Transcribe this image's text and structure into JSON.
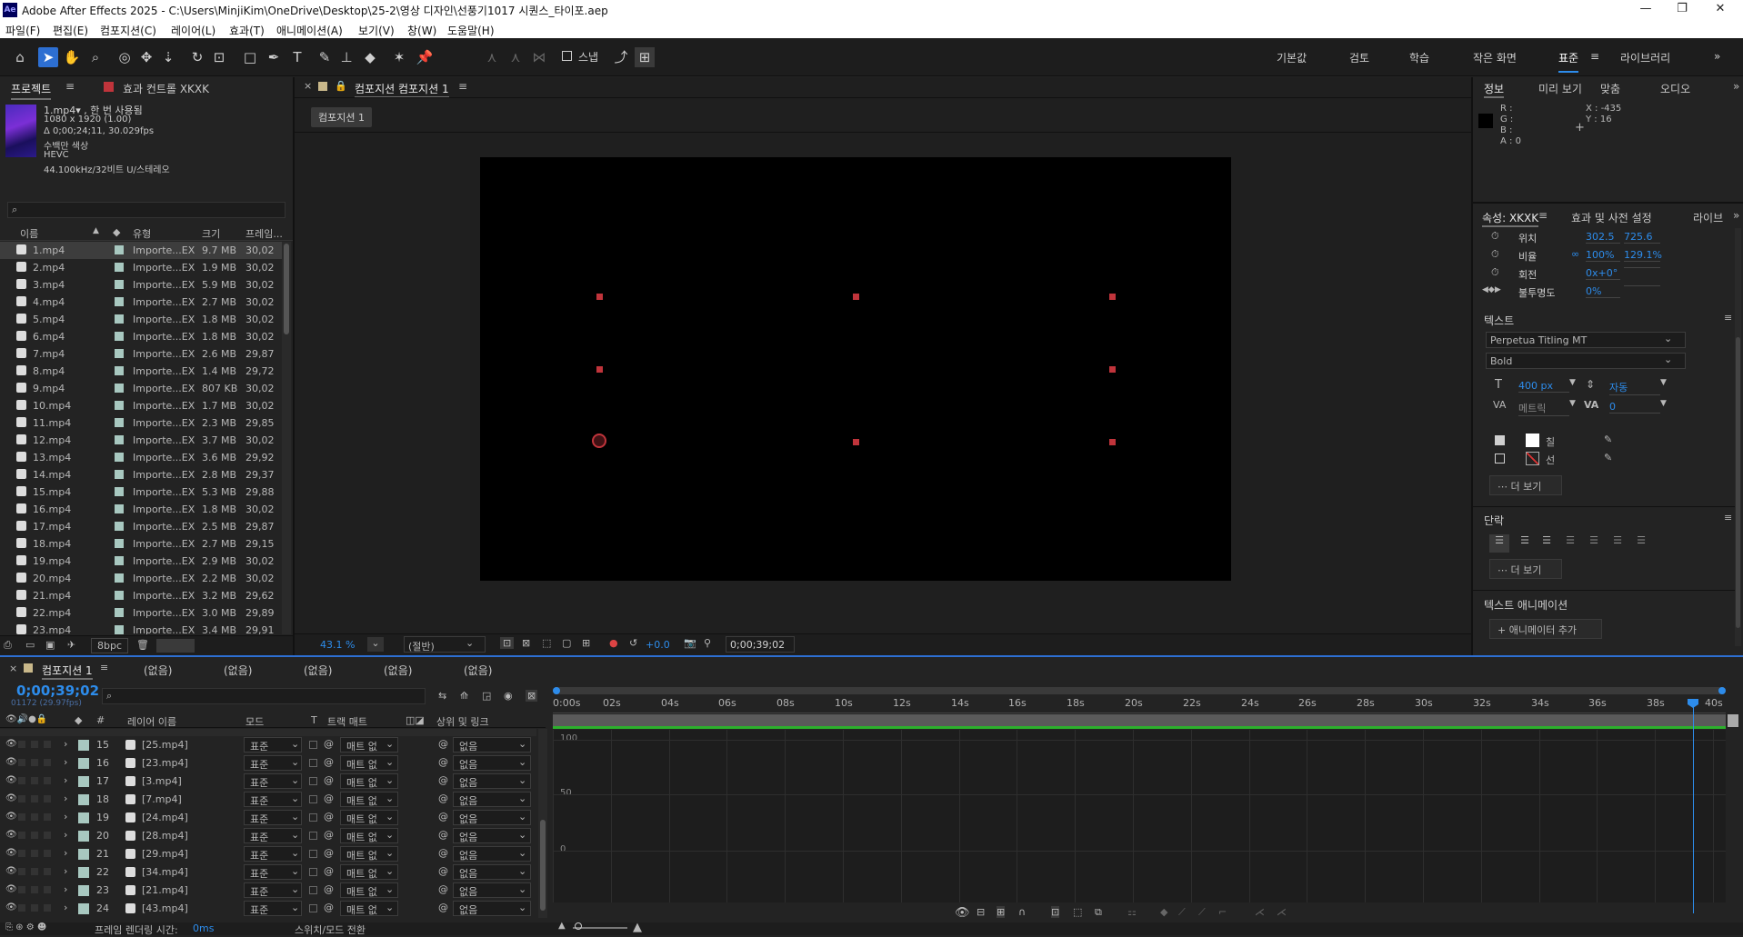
{
  "app": {
    "logo": "Ae",
    "title": "Adobe After Effects 2025 - C:\\Users\\MinjiKim\\OneDrive\\Desktop\\25-2\\영상 디자인\\선풍기1017 시퀀스_타이포.aep"
  },
  "window_controls": {
    "minimize": "—",
    "maximize": "❐",
    "close": "✕"
  },
  "menu": [
    "파일(F)",
    "편집(E)",
    "컴포지션(C)",
    "레이어(L)",
    "효과(T)",
    "애니메이션(A)",
    "보기(V)",
    "창(W)",
    "도움말(H)"
  ],
  "toolbar": {
    "snap_label": "스냅",
    "workspaces": [
      "기본값",
      "검토",
      "학습",
      "작은 화면",
      "표준",
      "라이브러리"
    ],
    "active_workspace": "표준",
    "more": "»"
  },
  "project": {
    "tabs": [
      "프로젝트",
      "효과 컨트롤 XKXK"
    ],
    "preview_info": [
      "1.mp4▾ , 한 번 사용됨",
      "1080 x 1920 (1.00)",
      "Δ 0;00;24;11, 30.029fps",
      "수백만 색상",
      "HEVC",
      "44.100kHz/32비트 U/스테레오"
    ],
    "search_placeholder": "",
    "columns": [
      "이름",
      "유형",
      "크기",
      "프레임..."
    ],
    "items": [
      {
        "name": "1.mp4",
        "type": "Importe...EX",
        "size": "9.7 MB",
        "fps": "30,02"
      },
      {
        "name": "2.mp4",
        "type": "Importe...EX",
        "size": "1.9 MB",
        "fps": "30,02"
      },
      {
        "name": "3.mp4",
        "type": "Importe...EX",
        "size": "5.9 MB",
        "fps": "30,02"
      },
      {
        "name": "4.mp4",
        "type": "Importe...EX",
        "size": "2.7 MB",
        "fps": "30,02"
      },
      {
        "name": "5.mp4",
        "type": "Importe...EX",
        "size": "1.8 MB",
        "fps": "30,02"
      },
      {
        "name": "6.mp4",
        "type": "Importe...EX",
        "size": "1.8 MB",
        "fps": "30,02"
      },
      {
        "name": "7.mp4",
        "type": "Importe...EX",
        "size": "2.6 MB",
        "fps": "29,87"
      },
      {
        "name": "8.mp4",
        "type": "Importe...EX",
        "size": "1.4 MB",
        "fps": "29,72"
      },
      {
        "name": "9.mp4",
        "type": "Importe...EX",
        "size": "807 KB",
        "fps": "30,02"
      },
      {
        "name": "10.mp4",
        "type": "Importe...EX",
        "size": "1.7 MB",
        "fps": "30,02"
      },
      {
        "name": "11.mp4",
        "type": "Importe...EX",
        "size": "2.3 MB",
        "fps": "29,85"
      },
      {
        "name": "12.mp4",
        "type": "Importe...EX",
        "size": "3.7 MB",
        "fps": "30,02"
      },
      {
        "name": "13.mp4",
        "type": "Importe...EX",
        "size": "3.6 MB",
        "fps": "29,92"
      },
      {
        "name": "14.mp4",
        "type": "Importe...EX",
        "size": "2.8 MB",
        "fps": "29,37"
      },
      {
        "name": "15.mp4",
        "type": "Importe...EX",
        "size": "5.3 MB",
        "fps": "29,88"
      },
      {
        "name": "16.mp4",
        "type": "Importe...EX",
        "size": "1.8 MB",
        "fps": "30,02"
      },
      {
        "name": "17.mp4",
        "type": "Importe...EX",
        "size": "2.5 MB",
        "fps": "29,87"
      },
      {
        "name": "18.mp4",
        "type": "Importe...EX",
        "size": "2.7 MB",
        "fps": "29,15"
      },
      {
        "name": "19.mp4",
        "type": "Importe...EX",
        "size": "2.9 MB",
        "fps": "30,02"
      },
      {
        "name": "20.mp4",
        "type": "Importe...EX",
        "size": "2.2 MB",
        "fps": "30,02"
      },
      {
        "name": "21.mp4",
        "type": "Importe...EX",
        "size": "3.2 MB",
        "fps": "29,62"
      },
      {
        "name": "22.mp4",
        "type": "Importe...EX",
        "size": "3.0 MB",
        "fps": "29,89"
      },
      {
        "name": "23.mp4",
        "type": "Importe...EX",
        "size": "3.4 MB",
        "fps": "29,91"
      }
    ],
    "footer_bpc": "8bpc"
  },
  "composition": {
    "tab_label": "컴포지션 컴포지션 1",
    "breadcrumb": "컴포지션 1",
    "zoom": "43.1 %",
    "resolution": "(절반)",
    "exposure": "+0.0",
    "timecode": "0;00;39;02"
  },
  "info": {
    "tabs": [
      "정보",
      "미리 보기",
      "맞춤",
      "오디오"
    ],
    "r": "R :",
    "g": "G :",
    "b": "B :",
    "a": "A : 0",
    "x": "X : -435",
    "y": "Y : 16"
  },
  "properties": {
    "tabs": [
      "속성: XKXK",
      "효과 및 사전 설정",
      "라이브"
    ],
    "transform": [
      {
        "label": "위치",
        "v1": "302.5",
        "v2": "725.6"
      },
      {
        "label": "비율",
        "v1": "100%",
        "v2": "129.1%"
      },
      {
        "label": "회전",
        "v1": "0x+0°",
        "v2": ""
      },
      {
        "label": "불투명도",
        "v1": "0%",
        "v2": ""
      }
    ],
    "text_heading": "텍스트",
    "font": "Perpetua Titling MT",
    "style": "Bold",
    "font_size": "400 px",
    "leading": "자동",
    "kerning": "메트릭",
    "tracking": "0",
    "fill_label": "칠",
    "stroke_label": "선",
    "more1": "더 보기",
    "paragraph_heading": "단락",
    "more2": "더 보기",
    "anim_heading": "텍스트 애니메이션",
    "add_animator": "애니메이터 추가"
  },
  "timeline": {
    "comp_tab": "컴포지션 1",
    "none_tabs": [
      "(없음)",
      "(없음)",
      "(없음)",
      "(없음)",
      "(없음)"
    ],
    "timecode": "0;00;39;02",
    "frames": "01172 (29.97fps)",
    "columns": {
      "name": "레이어 이름",
      "mode": "모드",
      "t": "T",
      "track": "트랙 매트",
      "parent": "상위 및 링크",
      "num": "#"
    },
    "layers": [
      {
        "num": "15",
        "name": "[25.mp4]",
        "mode": "표준",
        "matte": "매트 없",
        "parent": "없음"
      },
      {
        "num": "16",
        "name": "[23.mp4]",
        "mode": "표준",
        "matte": "매트 없",
        "parent": "없음"
      },
      {
        "num": "17",
        "name": "[3.mp4]",
        "mode": "표준",
        "matte": "매트 없",
        "parent": "없음"
      },
      {
        "num": "18",
        "name": "[7.mp4]",
        "mode": "표준",
        "matte": "매트 없",
        "parent": "없음"
      },
      {
        "num": "19",
        "name": "[24.mp4]",
        "mode": "표준",
        "matte": "매트 없",
        "parent": "없음"
      },
      {
        "num": "20",
        "name": "[28.mp4]",
        "mode": "표준",
        "matte": "매트 없",
        "parent": "없음"
      },
      {
        "num": "21",
        "name": "[29.mp4]",
        "mode": "표준",
        "matte": "매트 없",
        "parent": "없음"
      },
      {
        "num": "22",
        "name": "[34.mp4]",
        "mode": "표준",
        "matte": "매트 없",
        "parent": "없음"
      },
      {
        "num": "23",
        "name": "[21.mp4]",
        "mode": "표준",
        "matte": "매트 없",
        "parent": "없음"
      },
      {
        "num": "24",
        "name": "[43.mp4]",
        "mode": "표준",
        "matte": "매트 없",
        "parent": "없음"
      }
    ],
    "ruler": [
      "0:00s",
      "02s",
      "04s",
      "06s",
      "08s",
      "10s",
      "12s",
      "14s",
      "16s",
      "18s",
      "20s",
      "22s",
      "24s",
      "26s",
      "28s",
      "30s",
      "32s",
      "34s",
      "36s",
      "38s",
      "40s"
    ],
    "graph_labels": [
      "100",
      "50",
      "0"
    ],
    "footer_render": "프레임 렌더링 시간:",
    "footer_render_val": "0ms",
    "footer_switch": "스위치/모드 전환"
  },
  "colors": {
    "accent": "#2d8ceb",
    "handle": "#c0343b",
    "label": "#a8c8c0"
  }
}
